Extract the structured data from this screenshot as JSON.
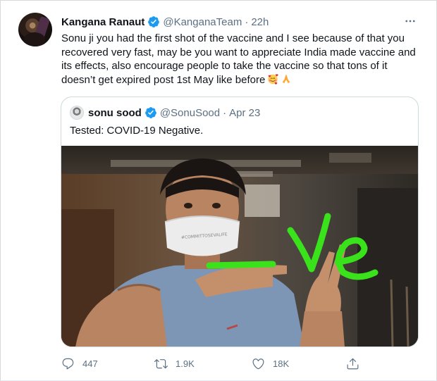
{
  "tweet": {
    "author_name": "Kangana Ranaut",
    "author_handle": "@KanganaTeam",
    "separator": "·",
    "time": "22h",
    "text": "Sonu ji you had the first shot of the vaccine and I see because of that you recovered very fast, may be you want to appreciate India made vaccine and its effects, also encourage people to take the vaccine so that tons of it doesn’t get expired post 1st May like before",
    "emojis": [
      "smiling-face-with-hearts-emoji",
      "folded-hands-emoji"
    ]
  },
  "quoted_tweet": {
    "author_name": "sonu sood",
    "author_handle": "@SonuSood",
    "separator": "·",
    "date": "Apr 23",
    "text": "Tested: COVID-19 Negative.",
    "photo_overlay_text": "-ve"
  },
  "actions": {
    "replies": "447",
    "retweets": "1.9K",
    "likes": "18K"
  },
  "colors": {
    "verified_blue": "#1d9bf0",
    "secondary_text": "#5b7083",
    "overlay_green": "#39e21b"
  }
}
